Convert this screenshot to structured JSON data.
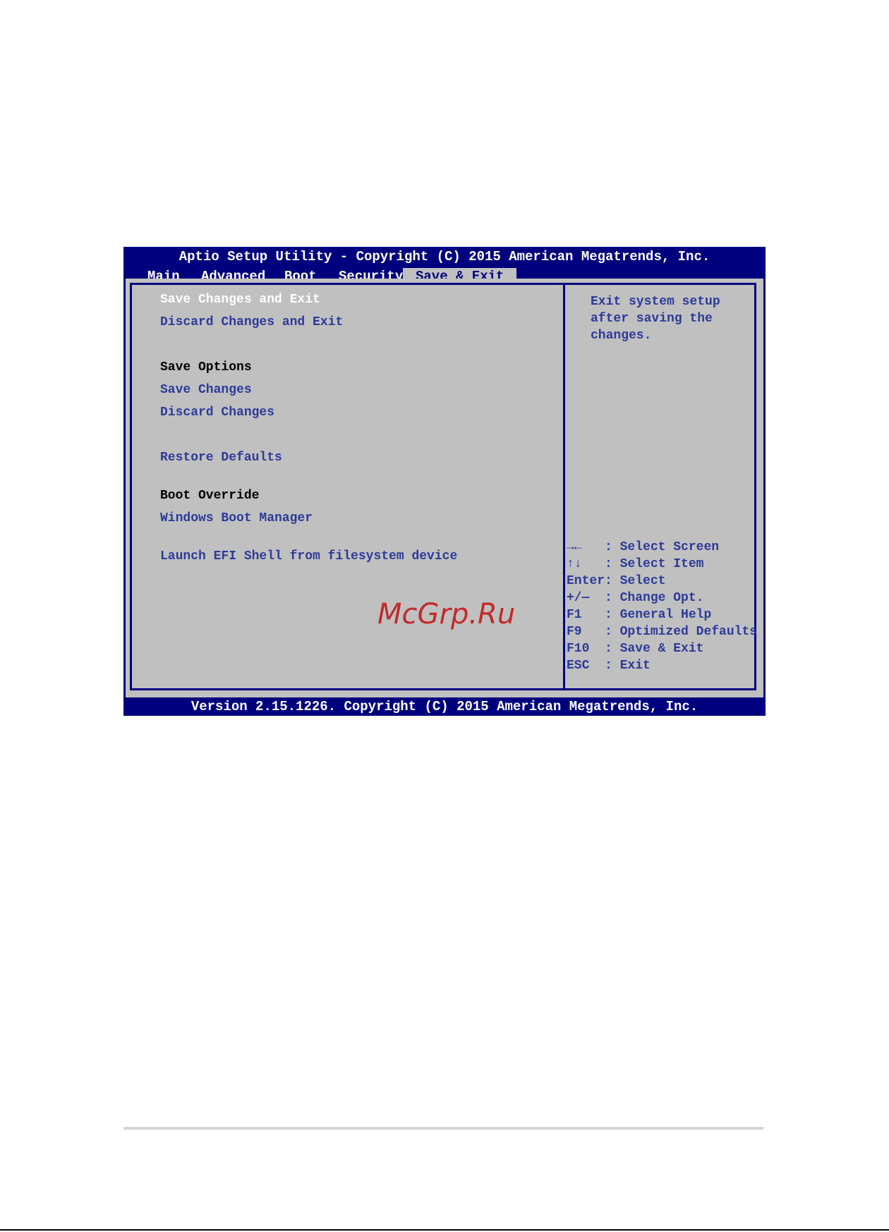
{
  "window": {
    "title": "Aptio Setup Utility - Copyright (C) 2015 American Megatrends, Inc.",
    "footer": "Version 2.15.1226. Copyright (C) 2015 American Megatrends, Inc."
  },
  "tabs": [
    {
      "label": "Main"
    },
    {
      "label": "Advanced"
    },
    {
      "label": "Boot"
    },
    {
      "label": "Security"
    },
    {
      "label": "Save & Exit",
      "active": true
    }
  ],
  "menu": {
    "save_changes_and_exit": "Save Changes and Exit",
    "discard_changes_and_exit": "Discard Changes and Exit",
    "save_options_header": "Save Options",
    "save_changes": "Save Changes",
    "discard_changes": "Discard Changes",
    "restore_defaults": "Restore Defaults",
    "boot_override_header": "Boot Override",
    "windows_boot_manager": "Windows Boot Manager",
    "launch_efi_shell": "Launch EFI Shell from filesystem device"
  },
  "help_text": "Exit system setup\nafter saving the\nchanges.",
  "key_help": [
    {
      "key": "→←   ",
      "action": ": Select Screen"
    },
    {
      "key": "↑↓   ",
      "action": ": Select Item"
    },
    {
      "key": "Enter",
      "action": ": Select"
    },
    {
      "key": "+/—  ",
      "action": ": Change Opt."
    },
    {
      "key": "F1   ",
      "action": ": General Help"
    },
    {
      "key": "F9   ",
      "action": ": Optimized Defaults"
    },
    {
      "key": "F10  ",
      "action": ": Save & Exit"
    },
    {
      "key": "ESC  ",
      "action": ": Exit"
    }
  ],
  "watermark": "McGrp.Ru",
  "colors": {
    "bios_blue": "#00007e",
    "panel_gray": "#c0c0c0",
    "text_blue": "#2c3a9a",
    "watermark_red": "#c22a2a"
  }
}
